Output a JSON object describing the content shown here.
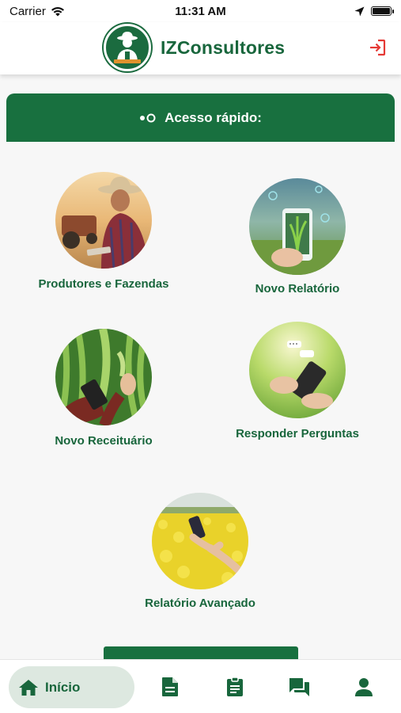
{
  "status_bar": {
    "carrier": "Carrier",
    "time": "11:31 AM"
  },
  "header": {
    "title": "IZConsultores",
    "logo_icon": "farmer-logo-icon",
    "logout_icon": "logout-icon"
  },
  "quick_access": {
    "title": "Acesso rápido:",
    "icon": "toggle-dots-icon"
  },
  "tiles": [
    {
      "label": "Produtores e Fazendas",
      "image": "farmer-with-tablet-photo"
    },
    {
      "label": "Novo Relatório",
      "image": "phone-with-plant-photo"
    },
    {
      "label": "Novo Receituário",
      "image": "hands-with-phone-in-corn-photo"
    },
    {
      "label": "Responder Perguntas",
      "image": "hands-texting-phone-photo"
    },
    {
      "label": "Relatório Avançado",
      "image": "phone-in-canola-field-photo"
    }
  ],
  "bottom_nav": {
    "home_label": "Início",
    "items": [
      "home-icon",
      "document-icon",
      "clipboard-icon",
      "chat-icon",
      "user-icon"
    ]
  },
  "colors": {
    "primary": "#18703f",
    "primary_text": "#18663c",
    "nav_active_bg": "#dde8e0",
    "logout": "#e53935"
  }
}
